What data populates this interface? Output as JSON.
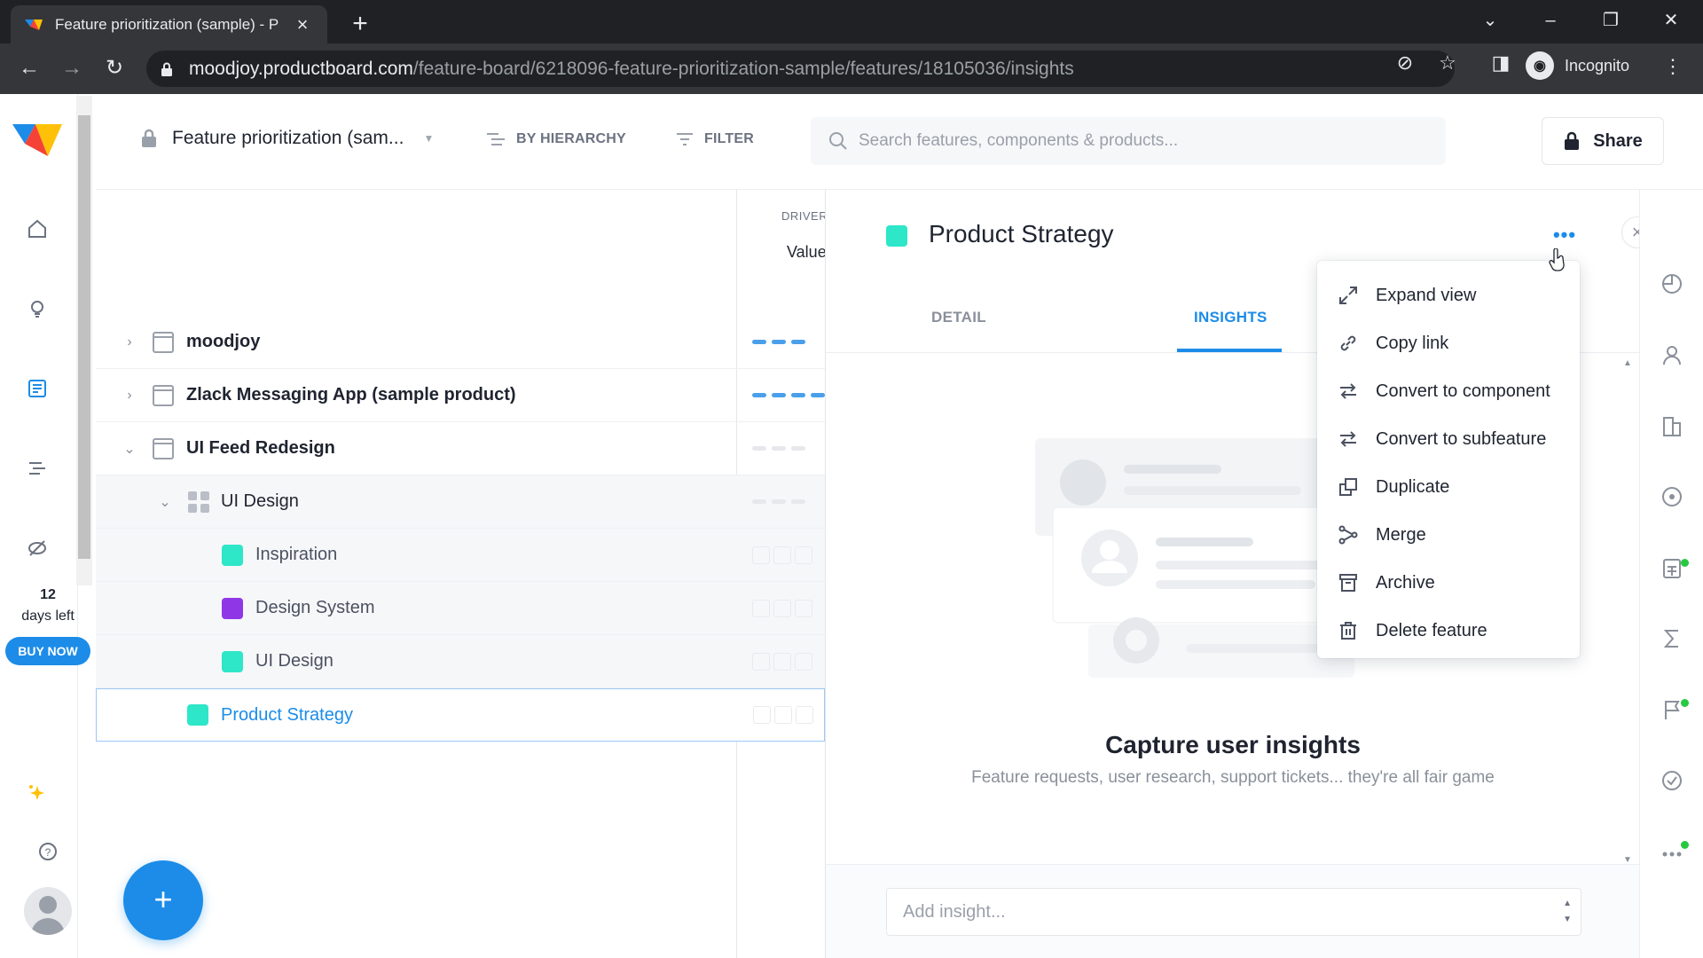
{
  "browser": {
    "tab_title": "Feature prioritization (sample) - P",
    "url_host": "moodjoy.productboard.com",
    "url_path": "/feature-board/6218096-feature-prioritization-sample/features/18105036/insights",
    "profile_label": "Incognito"
  },
  "sidebar": {
    "trial_days": "12",
    "trial_text": "days left",
    "buy_now": "BUY NOW"
  },
  "header": {
    "board_title": "Feature prioritization (sam...",
    "hierarchy_btn": "BY HIERARCHY",
    "filter_btn": "FILTER",
    "search_placeholder": "Search features, components & products...",
    "share_btn": "Share"
  },
  "list": {
    "driver_label": "DRIVER",
    "value_label": "Value",
    "rows": [
      {
        "label": "moodjoy",
        "type": "product"
      },
      {
        "label": "Zlack Messaging App (sample product)",
        "type": "product"
      },
      {
        "label": "UI Feed Redesign",
        "type": "product"
      },
      {
        "label": "UI Design",
        "type": "component"
      },
      {
        "label": "Inspiration",
        "type": "feature",
        "color": "#2ee6c8"
      },
      {
        "label": "Design System",
        "type": "feature",
        "color": "#8f37e6"
      },
      {
        "label": "UI Design",
        "type": "feature",
        "color": "#2ee6c8"
      },
      {
        "label": "Product Strategy",
        "type": "feature",
        "color": "#2ee6c8"
      }
    ]
  },
  "detail": {
    "title": "Product Strategy",
    "color": "#2ee6c8",
    "tabs": [
      "DETAIL",
      "INSIGHTS"
    ],
    "active_tab": "INSIGHTS",
    "more_label": "•••",
    "close_label": "×",
    "empty_title": "Capture user insights",
    "empty_sub": "Feature requests, user research, support tickets... they're all fair game",
    "insight_placeholder": "Add insight..."
  },
  "context_menu": {
    "items": [
      {
        "label": "Expand view",
        "icon": "expand-icon"
      },
      {
        "label": "Copy link",
        "icon": "link-icon"
      },
      {
        "label": "Convert to component",
        "icon": "convert-icon"
      },
      {
        "label": "Convert to subfeature",
        "icon": "convert-icon"
      },
      {
        "label": "Duplicate",
        "icon": "duplicate-icon"
      },
      {
        "label": "Merge",
        "icon": "merge-icon"
      },
      {
        "label": "Archive",
        "icon": "archive-icon"
      },
      {
        "label": "Delete feature",
        "icon": "trash-icon"
      }
    ]
  },
  "colors": {
    "accent": "#1c8ce8",
    "teal": "#2ee6c8",
    "purple": "#8f37e6"
  }
}
